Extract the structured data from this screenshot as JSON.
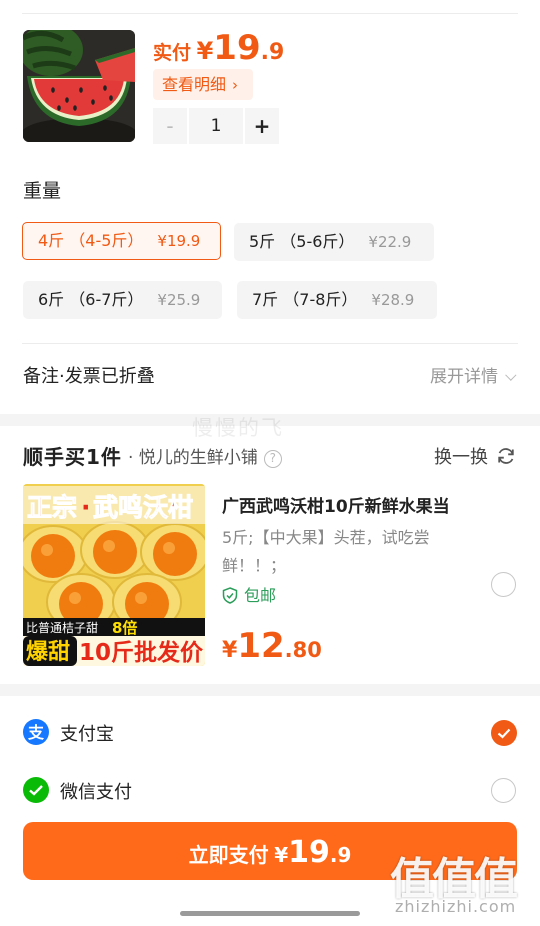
{
  "order": {
    "price_label": "实付",
    "price_yen": "¥",
    "price_int": "19",
    "price_dec": ".9",
    "detail_label": "查看明细",
    "qty_minus": "-",
    "qty_value": "1",
    "qty_plus": "+"
  },
  "weight": {
    "title": "重量",
    "options": [
      {
        "label": "4斤 （4-5斤）",
        "price": "¥19.9",
        "selected": true
      },
      {
        "label": "5斤 （5-6斤）",
        "price": "¥22.9",
        "selected": false
      },
      {
        "label": "6斤 （6-7斤）",
        "price": "¥25.9",
        "selected": false
      },
      {
        "label": "7斤 （7-8斤）",
        "price": "¥28.9",
        "selected": false
      }
    ]
  },
  "notes": {
    "label": "备注·发票已折叠",
    "expand": "展开详情"
  },
  "watermark": "慢慢的飞",
  "shunshou": {
    "title": "顺手买1件",
    "shop": "· 悦儿的生鲜小铺",
    "help": "?",
    "swap": "换一换",
    "product": {
      "image_banner_left": "正宗",
      "image_banner_dot": "·",
      "image_banner_right": "武鸣沃柑",
      "image_strip_text": "比普通桔子甜",
      "image_strip_num": "8倍",
      "image_badge": "爆甜",
      "image_footer": "10斤批发价",
      "name": "广西武鸣沃柑10斤新鲜水果当",
      "desc": "5斤;【中大果】头茬，试吃尝鲜！！；",
      "shipping": "包邮",
      "price_yen": "¥",
      "price_int": "12",
      "price_dec": ".80"
    }
  },
  "payment": {
    "methods": [
      {
        "label": "支付宝",
        "icon": "alipay-icon",
        "color": "#1677ff",
        "selected": true
      },
      {
        "label": "微信支付",
        "icon": "wechat-pay-icon",
        "color": "#09bb07",
        "selected": false
      }
    ],
    "button_label": "立即支付",
    "button_yen": "¥",
    "button_int": "19",
    "button_dec": ".9"
  },
  "site_watermark": {
    "mark": "值值值",
    "url": "zhizhizhi.com"
  },
  "colors": {
    "accent": "#f05a14",
    "pay_button": "#ff6a1a",
    "free_shipping": "#2c9d5a"
  }
}
